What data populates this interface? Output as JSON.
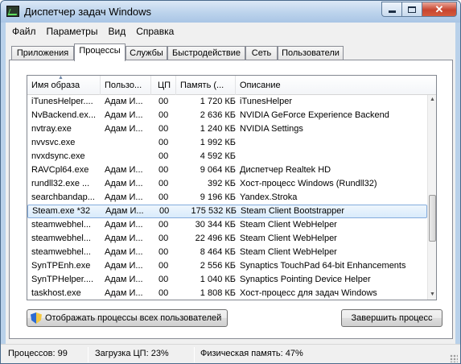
{
  "window": {
    "title": "Диспетчер задач Windows",
    "controls": {
      "close": "✕"
    }
  },
  "menu": [
    "Файл",
    "Параметры",
    "Вид",
    "Справка"
  ],
  "tabs": [
    "Приложения",
    "Процессы",
    "Службы",
    "Быстродействие",
    "Сеть",
    "Пользователи"
  ],
  "active_tab": "Процессы",
  "table": {
    "columns": [
      "Имя образа",
      "Пользо...",
      "ЦП",
      "Память (...",
      "Описание"
    ],
    "rows": [
      {
        "name": "iTunesHelper....",
        "user": "Адам И...",
        "cpu": "00",
        "mem": "1 720 КБ",
        "desc": "iTunesHelper"
      },
      {
        "name": "NvBackend.ex...",
        "user": "Адам И...",
        "cpu": "00",
        "mem": "2 636 КБ",
        "desc": "NVIDIA GeForce Experience Backend"
      },
      {
        "name": "nvtray.exe",
        "user": "Адам И...",
        "cpu": "00",
        "mem": "1 240 КБ",
        "desc": "NVIDIA Settings"
      },
      {
        "name": "nvvsvc.exe",
        "user": "",
        "cpu": "00",
        "mem": "1 992 КБ",
        "desc": ""
      },
      {
        "name": "nvxdsync.exe",
        "user": "",
        "cpu": "00",
        "mem": "4 592 КБ",
        "desc": ""
      },
      {
        "name": "RAVCpl64.exe",
        "user": "Адам И...",
        "cpu": "00",
        "mem": "9 064 КБ",
        "desc": "Диспетчер Realtek HD"
      },
      {
        "name": "rundll32.exe ...",
        "user": "Адам И...",
        "cpu": "00",
        "mem": "392 КБ",
        "desc": "Хост-процесс Windows (Rundll32)"
      },
      {
        "name": "searchbandap...",
        "user": "Адам И...",
        "cpu": "00",
        "mem": "9 196 КБ",
        "desc": "Yandex.Stroka"
      },
      {
        "name": "Steam.exe *32",
        "user": "Адам И...",
        "cpu": "00",
        "mem": "175 532 КБ",
        "desc": "Steam Client Bootstrapper",
        "selected": true
      },
      {
        "name": "steamwebhel...",
        "user": "Адам И...",
        "cpu": "00",
        "mem": "30 344 КБ",
        "desc": "Steam Client WebHelper"
      },
      {
        "name": "steamwebhel...",
        "user": "Адам И...",
        "cpu": "00",
        "mem": "22 496 КБ",
        "desc": "Steam Client WebHelper"
      },
      {
        "name": "steamwebhel...",
        "user": "Адам И...",
        "cpu": "00",
        "mem": "8 464 КБ",
        "desc": "Steam Client WebHelper"
      },
      {
        "name": "SynTPEnh.exe",
        "user": "Адам И...",
        "cpu": "00",
        "mem": "2 556 КБ",
        "desc": "Synaptics TouchPad 64-bit Enhancements"
      },
      {
        "name": "SynTPHelper....",
        "user": "Адам И...",
        "cpu": "00",
        "mem": "1 040 КБ",
        "desc": "Synaptics Pointing Device Helper"
      },
      {
        "name": "taskhost.exe",
        "user": "Адам И...",
        "cpu": "00",
        "mem": "1 808 КБ",
        "desc": "Хост-процесс для задач Windows"
      }
    ]
  },
  "buttons": {
    "show_all": "Отображать процессы всех пользователей",
    "end_process": "Завершить процесс"
  },
  "status": {
    "processes": "Процессов: 99",
    "cpu": "Загрузка ЦП: 23%",
    "memory": "Физическая память: 47%"
  },
  "icons": [
    "task-manager-icon",
    "minimize-icon",
    "maximize-icon",
    "close-icon",
    "uac-shield-icon",
    "sort-up-icon",
    "scroll-up-icon",
    "scroll-down-icon",
    "size-grip-icon"
  ]
}
